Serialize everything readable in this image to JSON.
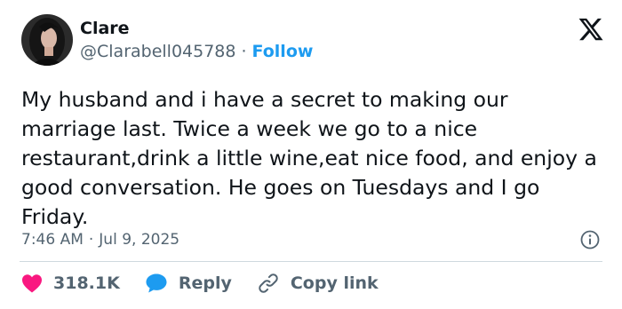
{
  "author": {
    "display_name": "Clare",
    "handle": "@Clarabell045788",
    "separator": "·",
    "follow_label": "Follow"
  },
  "tweet": {
    "text": "My husband and i have a secret to making our marriage last. Twice a week we go to a nice restaurant,drink a little wine,eat nice food, and enjoy a good conversation. He goes on Tuesdays and I go Friday.",
    "time": "7:46 AM",
    "separator": "·",
    "date": "Jul 9, 2025"
  },
  "actions": {
    "likes_count": "318.1K",
    "reply_label": "Reply",
    "copy_link_label": "Copy link"
  },
  "colors": {
    "accent": "#1d9bf0",
    "like": "#f91880",
    "text": "#0f1419",
    "muted": "#536471"
  },
  "icons": {
    "platform_logo": "x-logo-icon",
    "info": "info-icon",
    "like": "heart-icon",
    "reply": "speech-bubble-icon",
    "copy_link": "link-icon"
  }
}
